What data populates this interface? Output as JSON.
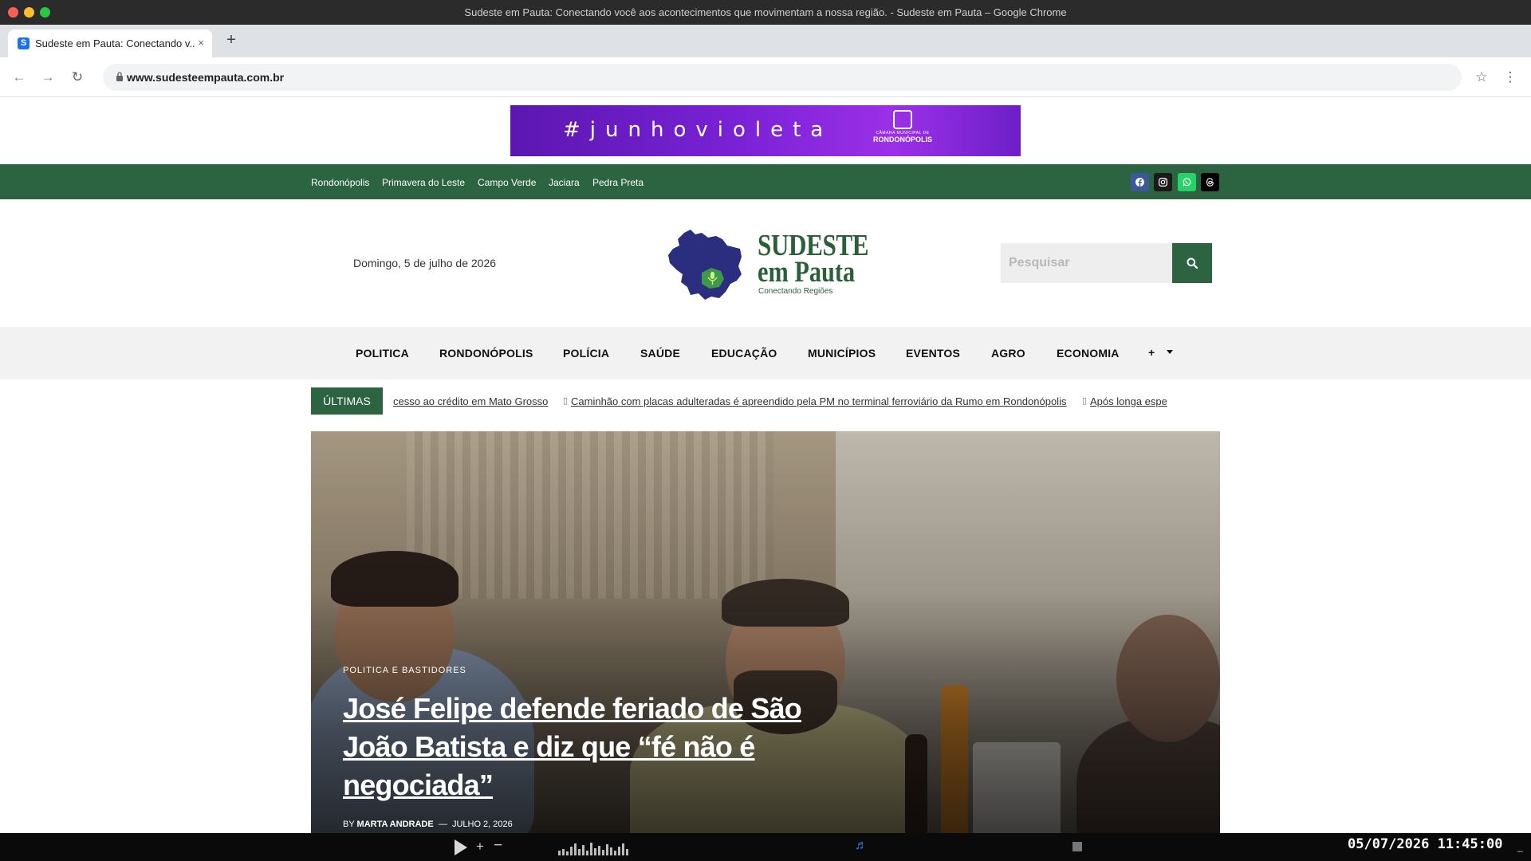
{
  "window": {
    "title": "Sudeste em Pauta: Conectando você aos acontecimentos que movimentam a nossa região. - Sudeste em Pauta – Google Chrome"
  },
  "tab": {
    "title": "Sudeste em Pauta: Conectando v...",
    "favicon_letter": "S",
    "close": "×",
    "new_tab": "+"
  },
  "toolbar": {
    "back": "←",
    "forward": "→",
    "reload": "↻",
    "url": "www.sudesteempauta.com.br",
    "star": "☆",
    "menu": "⋮"
  },
  "ad_banner": {
    "text": "#junhovioleta",
    "logo_small": "CÂMARA MUNICIPAL DE",
    "logo_big": "RONDONÓPOLIS"
  },
  "topbar": {
    "cities": [
      "Rondonópolis",
      "Primavera do Leste",
      "Campo Verde",
      "Jaciara",
      "Pedra Preta"
    ],
    "social": [
      "facebook-icon",
      "instagram-icon",
      "whatsapp-icon",
      "threads-icon"
    ]
  },
  "header": {
    "date": "Domingo, 5 de julho de 2026",
    "logo_line1": "SUDESTE",
    "logo_line2": "em Pauta",
    "logo_tagline": "Conectando Regiões",
    "search_placeholder": "Pesquisar"
  },
  "nav": {
    "items": [
      "POLITICA",
      "RONDONÓPOLIS",
      "POLÍCIA",
      "SAÚDE",
      "EDUCAÇÃO",
      "MUNICÍPIOS",
      "EVENTOS",
      "AGRO",
      "ECONOMIA"
    ],
    "more": "+"
  },
  "ticker": {
    "label": "ÚLTIMAS",
    "items": [
      "cesso ao crédito em Mato Grosso",
      "Caminhão com placas adulteradas é apreendido pela PM no terminal ferroviário da Rumo em Rondonópolis",
      "Após longa espe"
    ],
    "bullet": "▯"
  },
  "hero": {
    "category": "POLITICA E BASTIDORES",
    "headline": "José Felipe defende feriado de São João Batista e diz que “fé não é negociada”",
    "by": "BY",
    "author": "MARTA ANDRADE",
    "separator": "—",
    "date": "JULHO 2, 2026"
  },
  "player": {
    "vol_plus": "+",
    "vol_minus": "−",
    "note": "♬",
    "clock": "05/07/2026 11:45:00",
    "trailing": "_"
  }
}
